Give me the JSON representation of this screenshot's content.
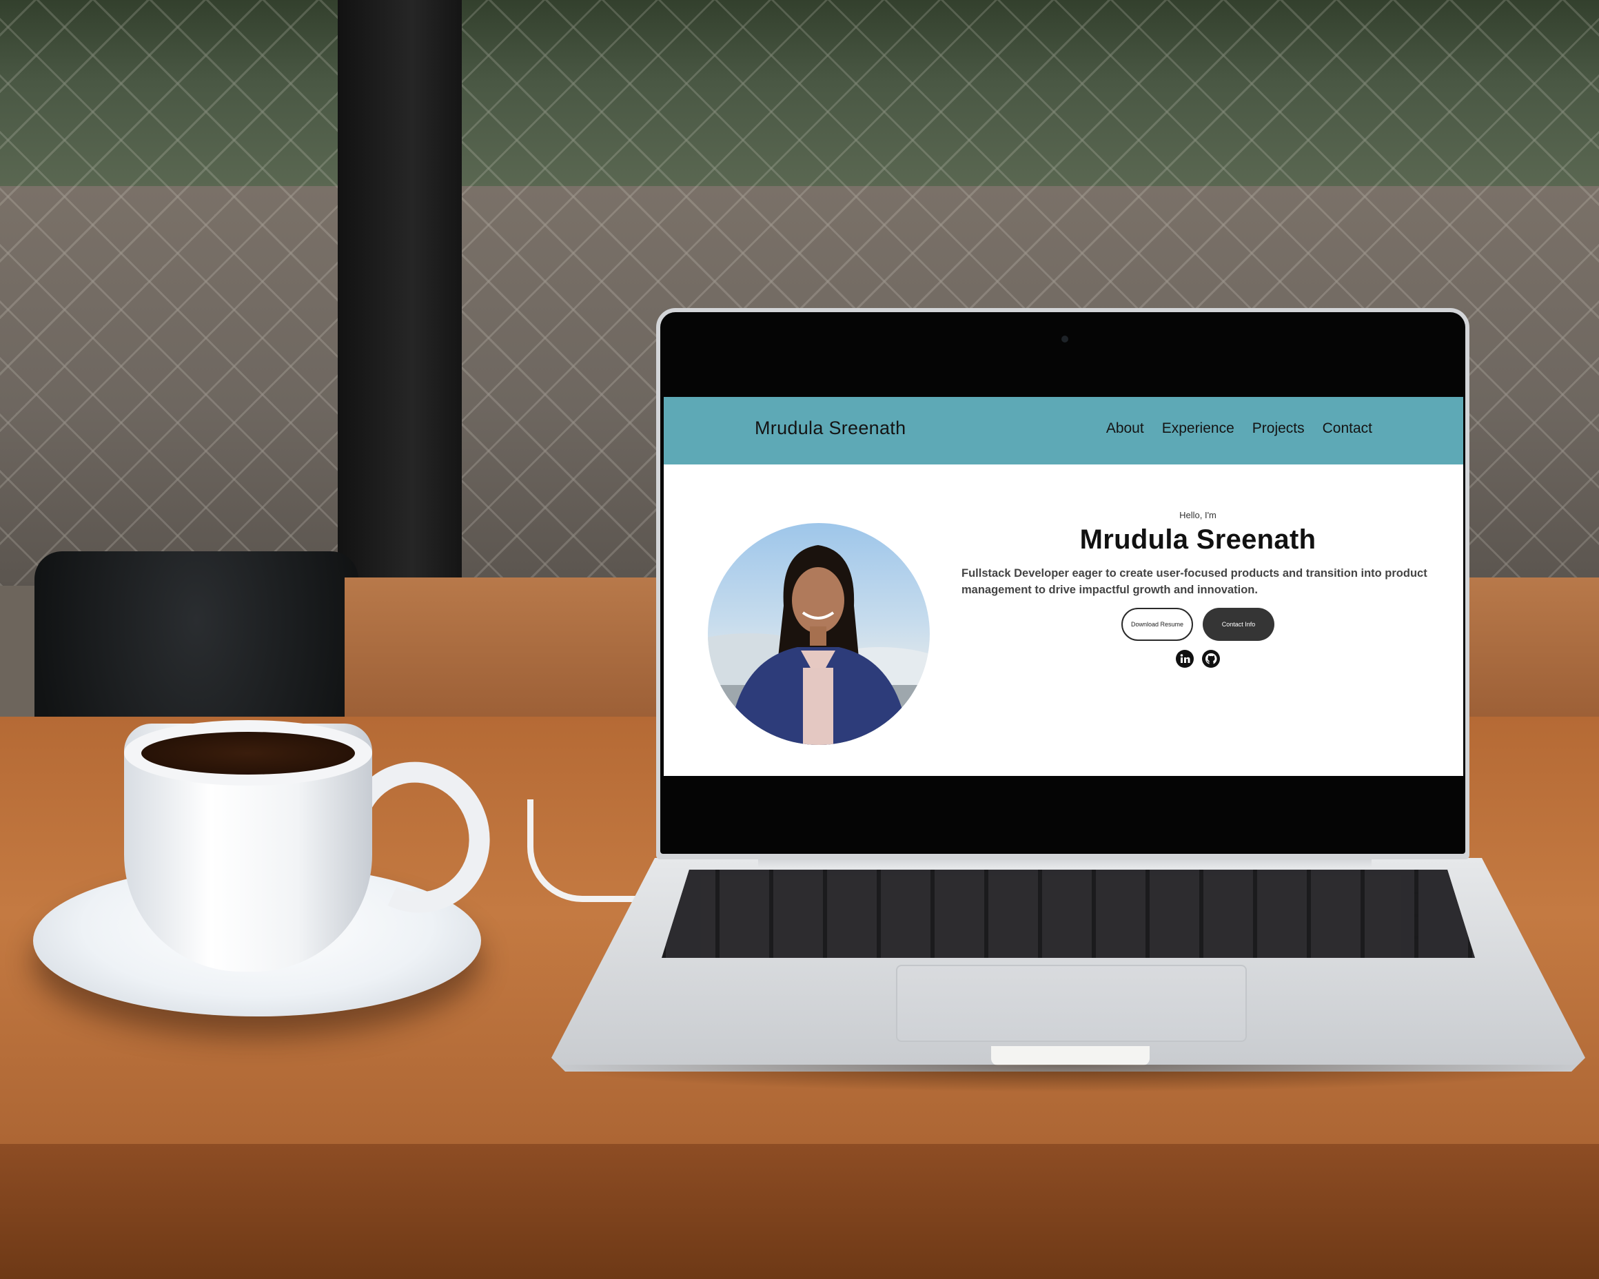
{
  "site": {
    "nav": {
      "brand": "Mrudula Sreenath",
      "links": [
        "About",
        "Experience",
        "Projects",
        "Contact"
      ],
      "background_color": "#5ea9b6"
    },
    "hero": {
      "greeting": "Hello, I'm",
      "name": "Mrudula Sreenath",
      "description": "Fullstack Developer eager to create user-focused products and transition into product management to drive impactful growth and innovation.",
      "buttons": {
        "download_resume": "Download Resume",
        "contact_info": "Contact Info"
      },
      "social_icons": [
        "linkedin-icon",
        "github-icon"
      ],
      "profile_image": "profile-photo"
    }
  }
}
